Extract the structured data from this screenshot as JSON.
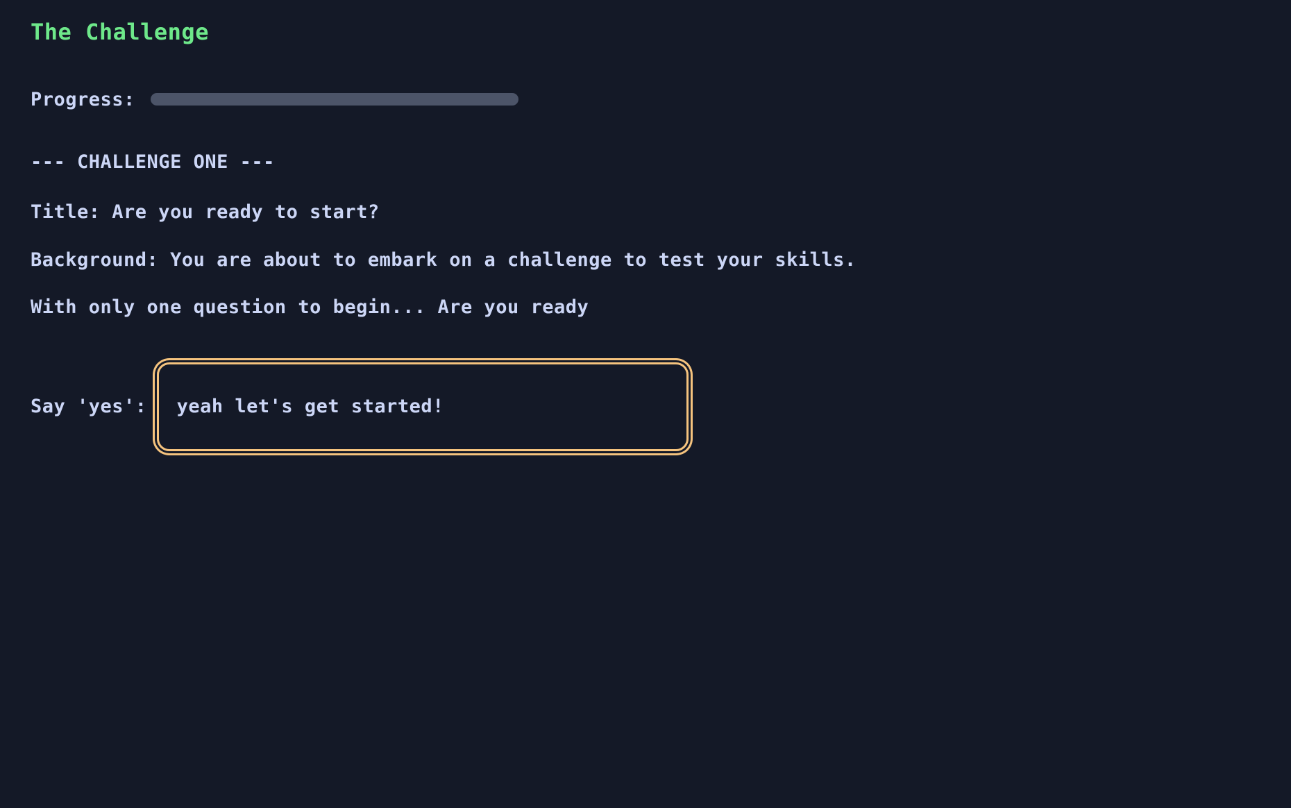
{
  "app": {
    "title": "The Challenge",
    "title_color": "#6ee88a",
    "background_color": "#141927",
    "text_color": "#ccd6f6"
  },
  "progress": {
    "label": "Progress:",
    "percent": 0,
    "track_color": "#4c5468",
    "fill_color": "#4c5468"
  },
  "challenge": {
    "heading": "--- CHALLENGE ONE ---",
    "title_line": "Title: Are you ready to start?",
    "background_line": "Background: You are about to embark on a challenge to test your skills.",
    "question_line": "With only one question to begin... Are you ready"
  },
  "prompt": {
    "label": "Say 'yes':",
    "value": "yeah let's get started!",
    "placeholder": "",
    "focus_ring_color": "#f5c37e",
    "focused": true
  }
}
